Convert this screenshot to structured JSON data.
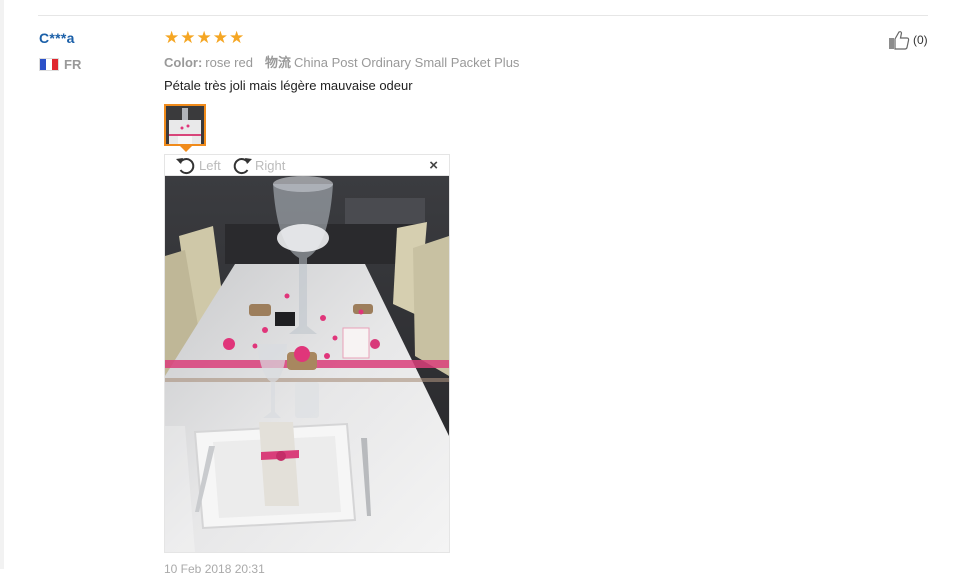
{
  "reviewer": {
    "name": "C***a",
    "country_code": "FR",
    "flag_colors": [
      "#2b50c8",
      "#ffffff",
      "#e0262e"
    ]
  },
  "review": {
    "rating": 5,
    "color_key": "Color:",
    "color_value": "rose red",
    "shipping_key": "物流",
    "shipping_value": "China Post Ordinary Small Packet Plus",
    "text": "Pétale très joli mais légère mauvaise odeur",
    "date": "10 Feb 2018 20:31"
  },
  "viewer": {
    "rotate_left_label": "Left",
    "rotate_right_label": "Right",
    "close_label": "×"
  },
  "helpful": {
    "count_label": "(0)"
  },
  "colors": {
    "accent_orange": "#f08b1b",
    "star": "#f5a623",
    "link_blue": "#1a5fa8"
  }
}
